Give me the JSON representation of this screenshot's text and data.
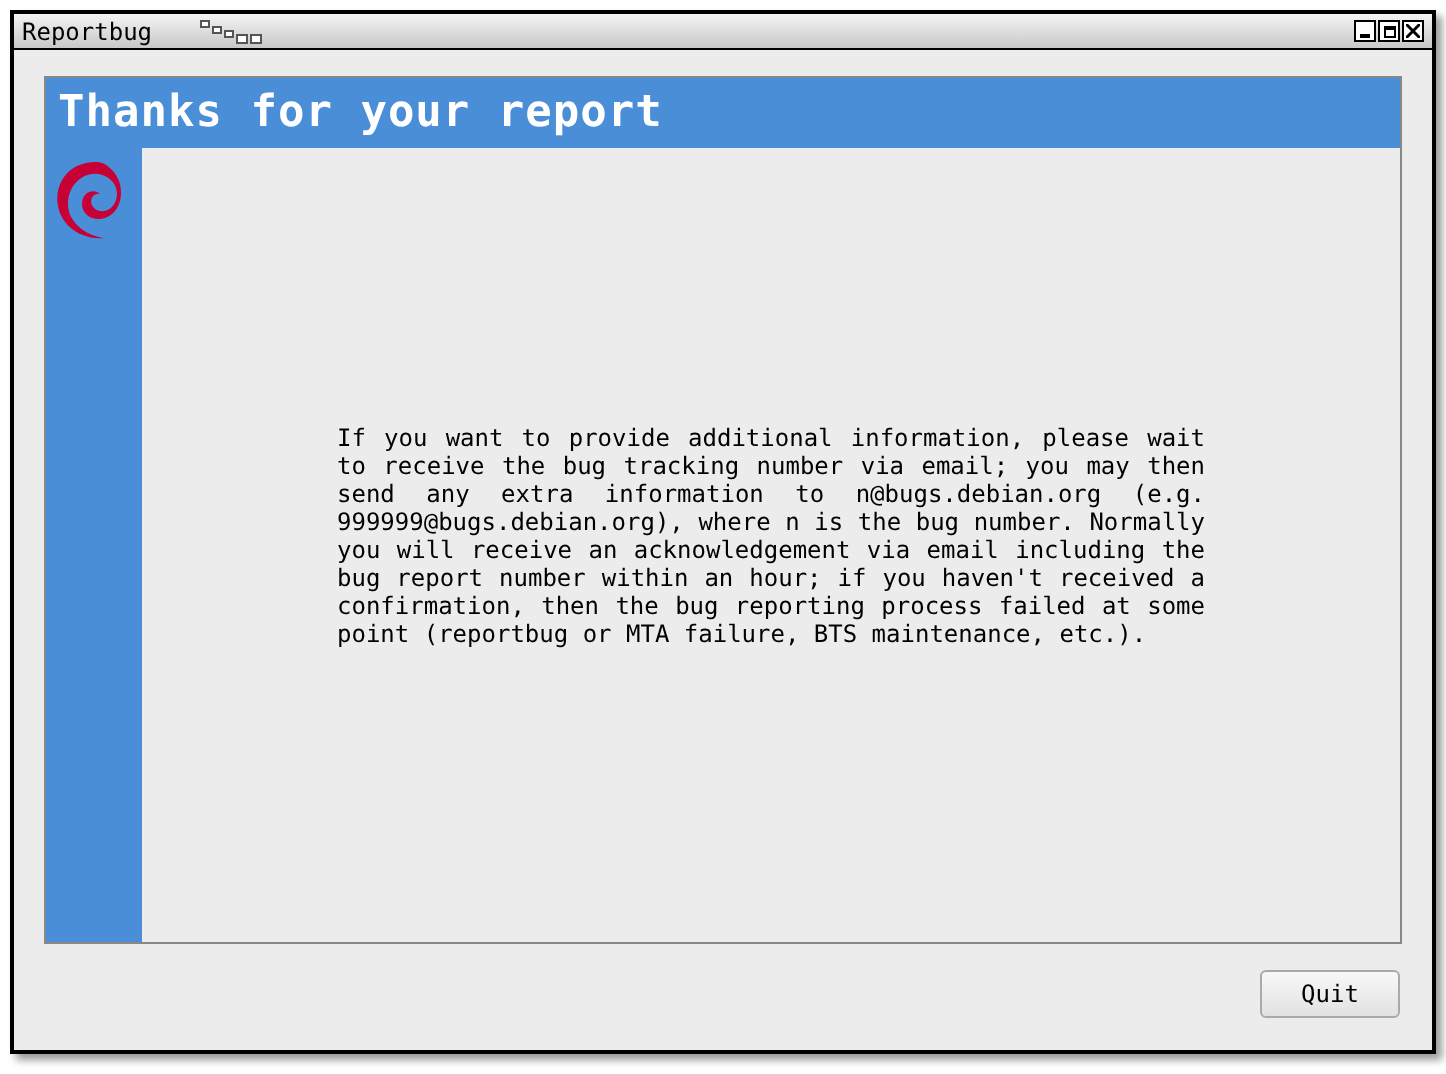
{
  "window": {
    "title": "Reportbug"
  },
  "header": {
    "title": "Thanks for your report"
  },
  "message": "If you want to provide additional information, please wait to receive the bug tracking number via email; you may then send any extra information to n@bugs.debian.org (e.g. 999999@bugs.debian.org), where n is the bug number. Normally you will receive an acknowledgement via email including the bug report number within an hour; if you haven't received a confirmation, then the bug reporting process failed at some point (reportbug or MTA failure, BTS maintenance, etc.).",
  "buttons": [
    "Quit"
  ]
}
